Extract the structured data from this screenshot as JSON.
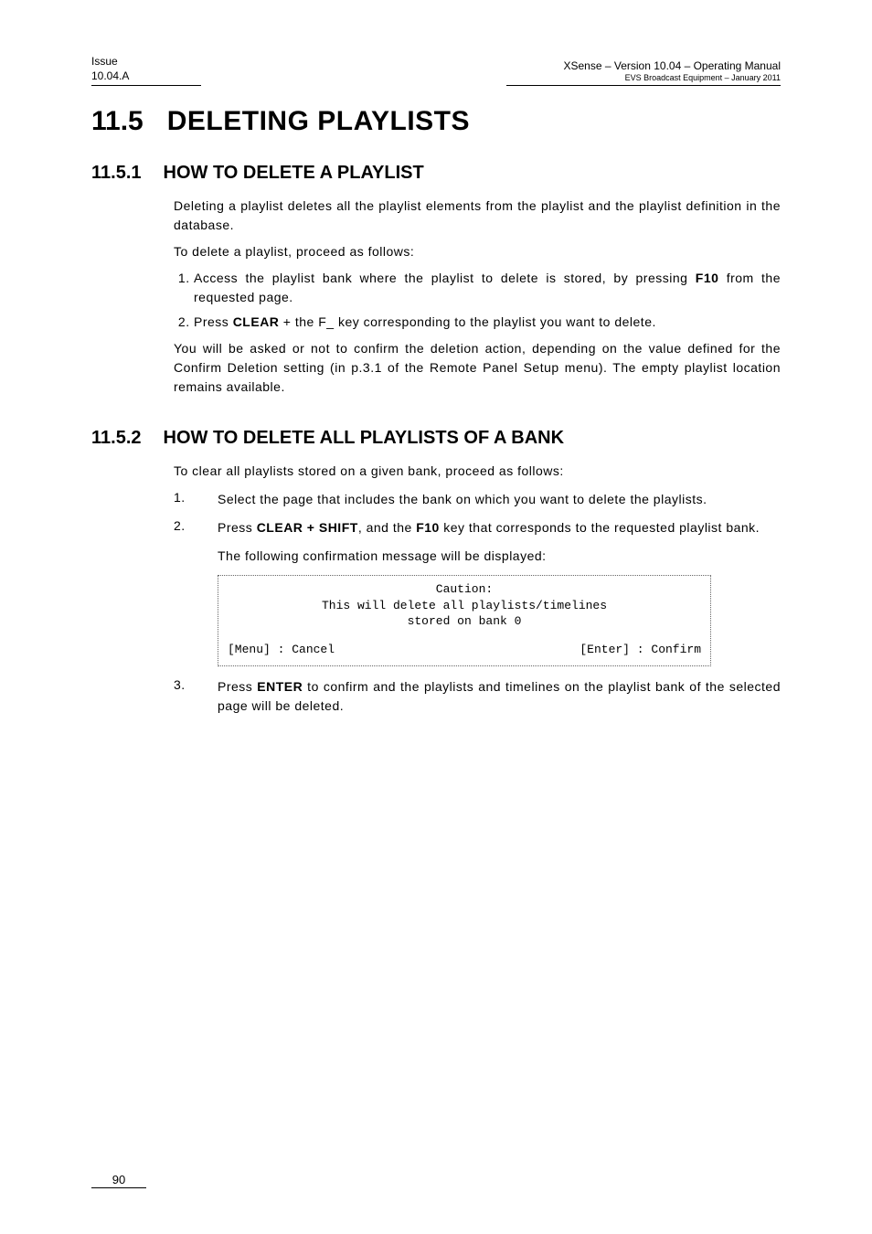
{
  "header": {
    "issue_label": "Issue",
    "issue_value": "10.04.A",
    "product_line": "XSense – Version 10.04 – Operating Manual",
    "company_line": "EVS Broadcast Equipment  – January 2011"
  },
  "h1": {
    "num": "11.5",
    "text": "DELETING PLAYLISTS"
  },
  "s1": {
    "num": "11.5.1",
    "title": "HOW TO DELETE A PLAYLIST",
    "p1": "Deleting a playlist deletes all the playlist elements from the playlist and the playlist definition in the database.",
    "p2": "To delete a playlist, proceed as follows:",
    "li1a": "Access the playlist bank where the playlist to delete is stored, by pressing ",
    "li1_key": "F10",
    "li1b": " from the requested page.",
    "li2a": "Press ",
    "li2_key": "CLEAR",
    "li2b": " + the F_ key corresponding to the playlist you want to delete.",
    "p3": "You will be asked or not to confirm the deletion action, depending on the value defined for the Confirm Deletion setting (in p.3.1 of the Remote Panel Setup menu). The empty playlist location remains available."
  },
  "s2": {
    "num": "11.5.2",
    "title": "HOW TO DELETE ALL PLAYLISTS OF A BANK",
    "p1": "To clear all playlists stored on a given bank, proceed as follows:",
    "li1": "Select the page that includes the bank on which you want to delete the playlists.",
    "li2a": "Press ",
    "li2_key1": "CLEAR + SHIFT",
    "li2b": ", and the ",
    "li2_key2": "F10",
    "li2c": " key that corresponds to the requested playlist bank.",
    "li2_tail": "The following confirmation message will be displayed:",
    "caution_l1": "Caution:",
    "caution_l2": "This will delete all playlists/timelines",
    "caution_l3": "stored on bank 0",
    "caution_cancel": "[Menu] : Cancel",
    "caution_confirm": "[Enter] : Confirm",
    "li3a": "Press ",
    "li3_key": "ENTER",
    "li3b": " to confirm and the playlists and timelines on the playlist bank of the selected page will be deleted."
  },
  "page_number": "90"
}
